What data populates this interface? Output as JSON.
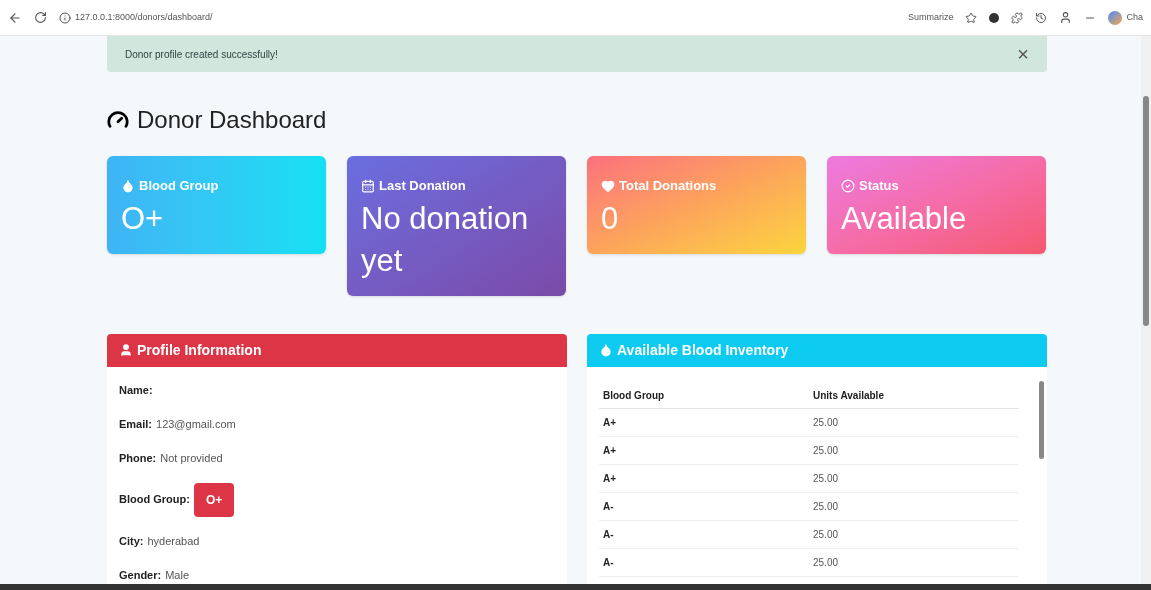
{
  "browser": {
    "url": "127.0.0.1:8000/donors/dashboard/",
    "summarize": "Summarize",
    "profile_button": "Cha"
  },
  "alert": {
    "message": "Donor profile created successfully!",
    "close": "×"
  },
  "page_title": "Donor Dashboard",
  "stat_cards": [
    {
      "kind": "drop",
      "label": "Blood Group",
      "value": "O+"
    },
    {
      "kind": "calendar",
      "label": "Last Donation",
      "value": "No donation yet"
    },
    {
      "kind": "heart",
      "label": "Total Donations",
      "value": "0"
    },
    {
      "kind": "check",
      "label": "Status",
      "value": "Available"
    }
  ],
  "profile": {
    "title": "Profile Information",
    "fields": [
      {
        "label": "Name:"
      },
      {
        "label": "Email:",
        "value": "123@gmail.com"
      },
      {
        "label": "Phone:",
        "value": "Not provided"
      },
      {
        "label": "Blood Group:",
        "badge": "O+"
      },
      {
        "label": "City:",
        "value": "hyderabad"
      },
      {
        "label": "Gender:",
        "value": "Male"
      }
    ]
  },
  "inventory": {
    "title": "Available Blood Inventory",
    "columns": [
      "Blood Group",
      "Units Available"
    ],
    "rows": [
      [
        "A+",
        "25.00"
      ],
      [
        "A+",
        "25.00"
      ],
      [
        "A+",
        "25.00"
      ],
      [
        "A-",
        "25.00"
      ],
      [
        "A-",
        "25.00"
      ],
      [
        "A-",
        "25.00"
      ]
    ]
  }
}
